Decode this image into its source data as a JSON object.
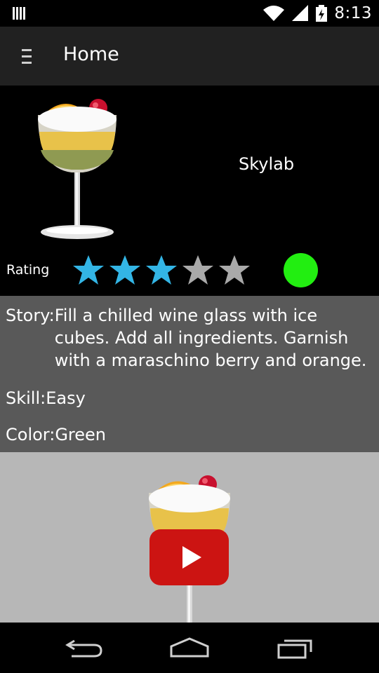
{
  "status_bar": {
    "time": "8:13",
    "icons": [
      "notification-bars-icon",
      "wifi-icon",
      "signal-icon",
      "battery-charging-icon"
    ]
  },
  "action_bar": {
    "menu_icon": "menu-icon",
    "title": "Home"
  },
  "drink": {
    "name": "Skylab",
    "image": "cocktail-glass-image",
    "rating_label": "Rating",
    "rating_value": 3,
    "rating_max": 5,
    "star_colors": {
      "filled": "#33b5e5",
      "empty": "#a9a9a9"
    },
    "color_indicator": "#22ee11"
  },
  "details": {
    "story_label": "Story:",
    "story_text": "Fill a chilled wine glass with ice cubes. Add all ingredients. Garnish with a maraschino berry and orange.",
    "skill_label": "Skill:",
    "skill_value": "Easy",
    "color_label": "Color:",
    "color_value": "Green"
  },
  "video": {
    "thumbnail": "cocktail-glass-image",
    "play_icon": "youtube-play-icon",
    "play_color": "#cc1412"
  },
  "nav_bar": {
    "buttons": [
      "back-icon",
      "home-icon",
      "recent-apps-icon"
    ]
  }
}
